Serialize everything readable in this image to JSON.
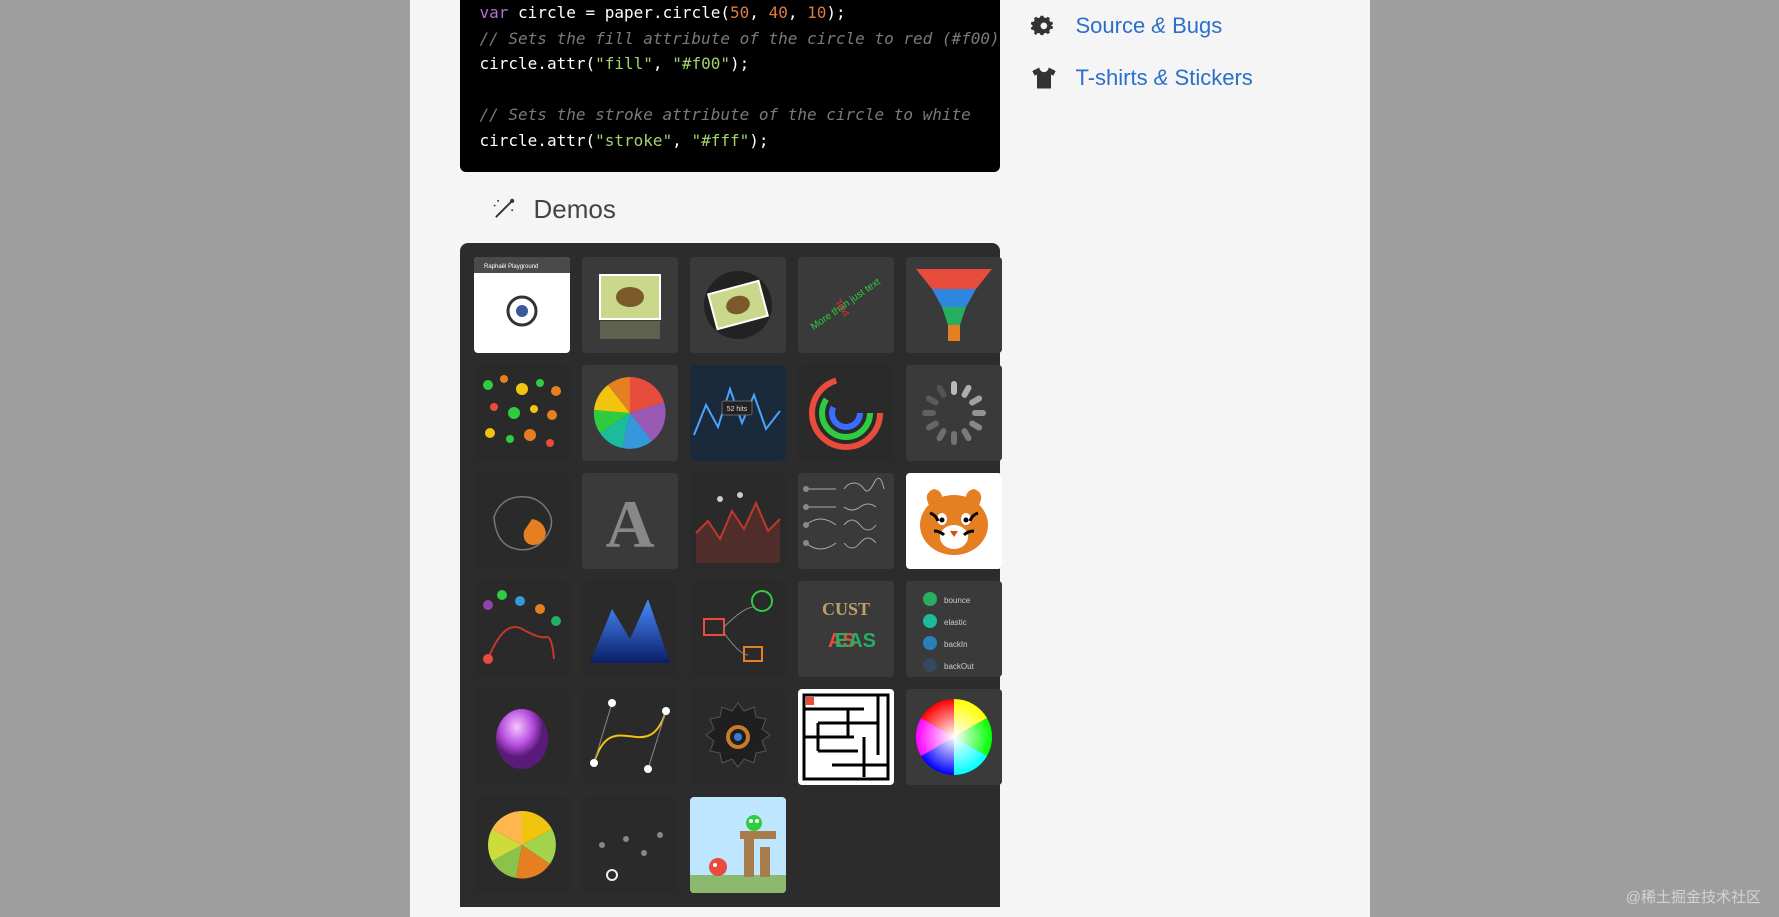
{
  "code": {
    "lines": [
      {
        "type": "stmt",
        "parts": [
          [
            "kw",
            "var"
          ],
          [
            "sp",
            " "
          ],
          [
            "var",
            "circle"
          ],
          [
            "sp",
            " "
          ],
          [
            "punc",
            "="
          ],
          [
            "sp",
            " "
          ],
          [
            "var",
            "paper"
          ],
          [
            "punc",
            "."
          ],
          [
            "var",
            "circle"
          ],
          [
            "punc",
            "("
          ],
          [
            "num",
            "50"
          ],
          [
            "punc",
            ","
          ],
          [
            "sp",
            " "
          ],
          [
            "num",
            "40"
          ],
          [
            "punc",
            ","
          ],
          [
            "sp",
            " "
          ],
          [
            "num",
            "10"
          ],
          [
            "punc",
            ");"
          ]
        ]
      },
      {
        "type": "cmt",
        "text": "// Sets the fill attribute of the circle to red (#f00)"
      },
      {
        "type": "stmt",
        "parts": [
          [
            "var",
            "circle"
          ],
          [
            "punc",
            "."
          ],
          [
            "var",
            "attr"
          ],
          [
            "punc",
            "("
          ],
          [
            "str",
            "\"fill\""
          ],
          [
            "punc",
            ","
          ],
          [
            "sp",
            " "
          ],
          [
            "str",
            "\"#f00\""
          ],
          [
            "punc",
            ");"
          ]
        ]
      },
      {
        "type": "blank"
      },
      {
        "type": "cmt",
        "text": "// Sets the stroke attribute of the circle to white"
      },
      {
        "type": "stmt",
        "parts": [
          [
            "var",
            "circle"
          ],
          [
            "punc",
            "."
          ],
          [
            "var",
            "attr"
          ],
          [
            "punc",
            "("
          ],
          [
            "str",
            "\"stroke\""
          ],
          [
            "punc",
            ","
          ],
          [
            "sp",
            " "
          ],
          [
            "str",
            "\"#fff\""
          ],
          [
            "punc",
            ");"
          ]
        ]
      }
    ]
  },
  "demos_heading": "Demos",
  "demos": [
    {
      "id": "playground",
      "label": "Raphaël Playground"
    },
    {
      "id": "reflection",
      "label": "Image reflection"
    },
    {
      "id": "rotation",
      "label": "Image rotation"
    },
    {
      "id": "text-rotation",
      "label": "Text rotation"
    },
    {
      "id": "funnel",
      "label": "Funnel chart"
    },
    {
      "id": "dots",
      "label": "Dots chart"
    },
    {
      "id": "pie",
      "label": "Pie chart"
    },
    {
      "id": "analytics",
      "label": "Line analytics"
    },
    {
      "id": "polar",
      "label": "Polar clock"
    },
    {
      "id": "spinner",
      "label": "Spinner"
    },
    {
      "id": "australia",
      "label": "Australia map"
    },
    {
      "id": "letter",
      "label": "Letter A"
    },
    {
      "id": "micro-chart",
      "label": "Micro chart"
    },
    {
      "id": "easing",
      "label": "Easing types"
    },
    {
      "id": "tiger",
      "label": "Tiger"
    },
    {
      "id": "ball",
      "label": "Bouncing ball"
    },
    {
      "id": "mountain",
      "label": "Gradient chart"
    },
    {
      "id": "graffle",
      "label": "Graffle"
    },
    {
      "id": "custom",
      "label": "Custom easing"
    },
    {
      "id": "easing-list",
      "label": "Easing list"
    },
    {
      "id": "sphere",
      "label": "Glow sphere"
    },
    {
      "id": "curver",
      "label": "Curve editor"
    },
    {
      "id": "gear",
      "label": "Gear"
    },
    {
      "id": "maze",
      "label": "Maze"
    },
    {
      "id": "color-wheel",
      "label": "Color wheel"
    },
    {
      "id": "pie2",
      "label": "Growing pie"
    },
    {
      "id": "dots2",
      "label": "Dots"
    },
    {
      "id": "angry",
      "label": "Angry birds"
    }
  ],
  "sidebar": {
    "links": [
      {
        "icon": "gear",
        "label_pre": "Source ",
        "label_amp": "&",
        "label_post": " Bugs"
      },
      {
        "icon": "tshirt",
        "label_pre": "T-shirts ",
        "label_amp": "&",
        "label_post": " Stickers"
      }
    ]
  },
  "watermark": "@稀土掘金技术社区"
}
